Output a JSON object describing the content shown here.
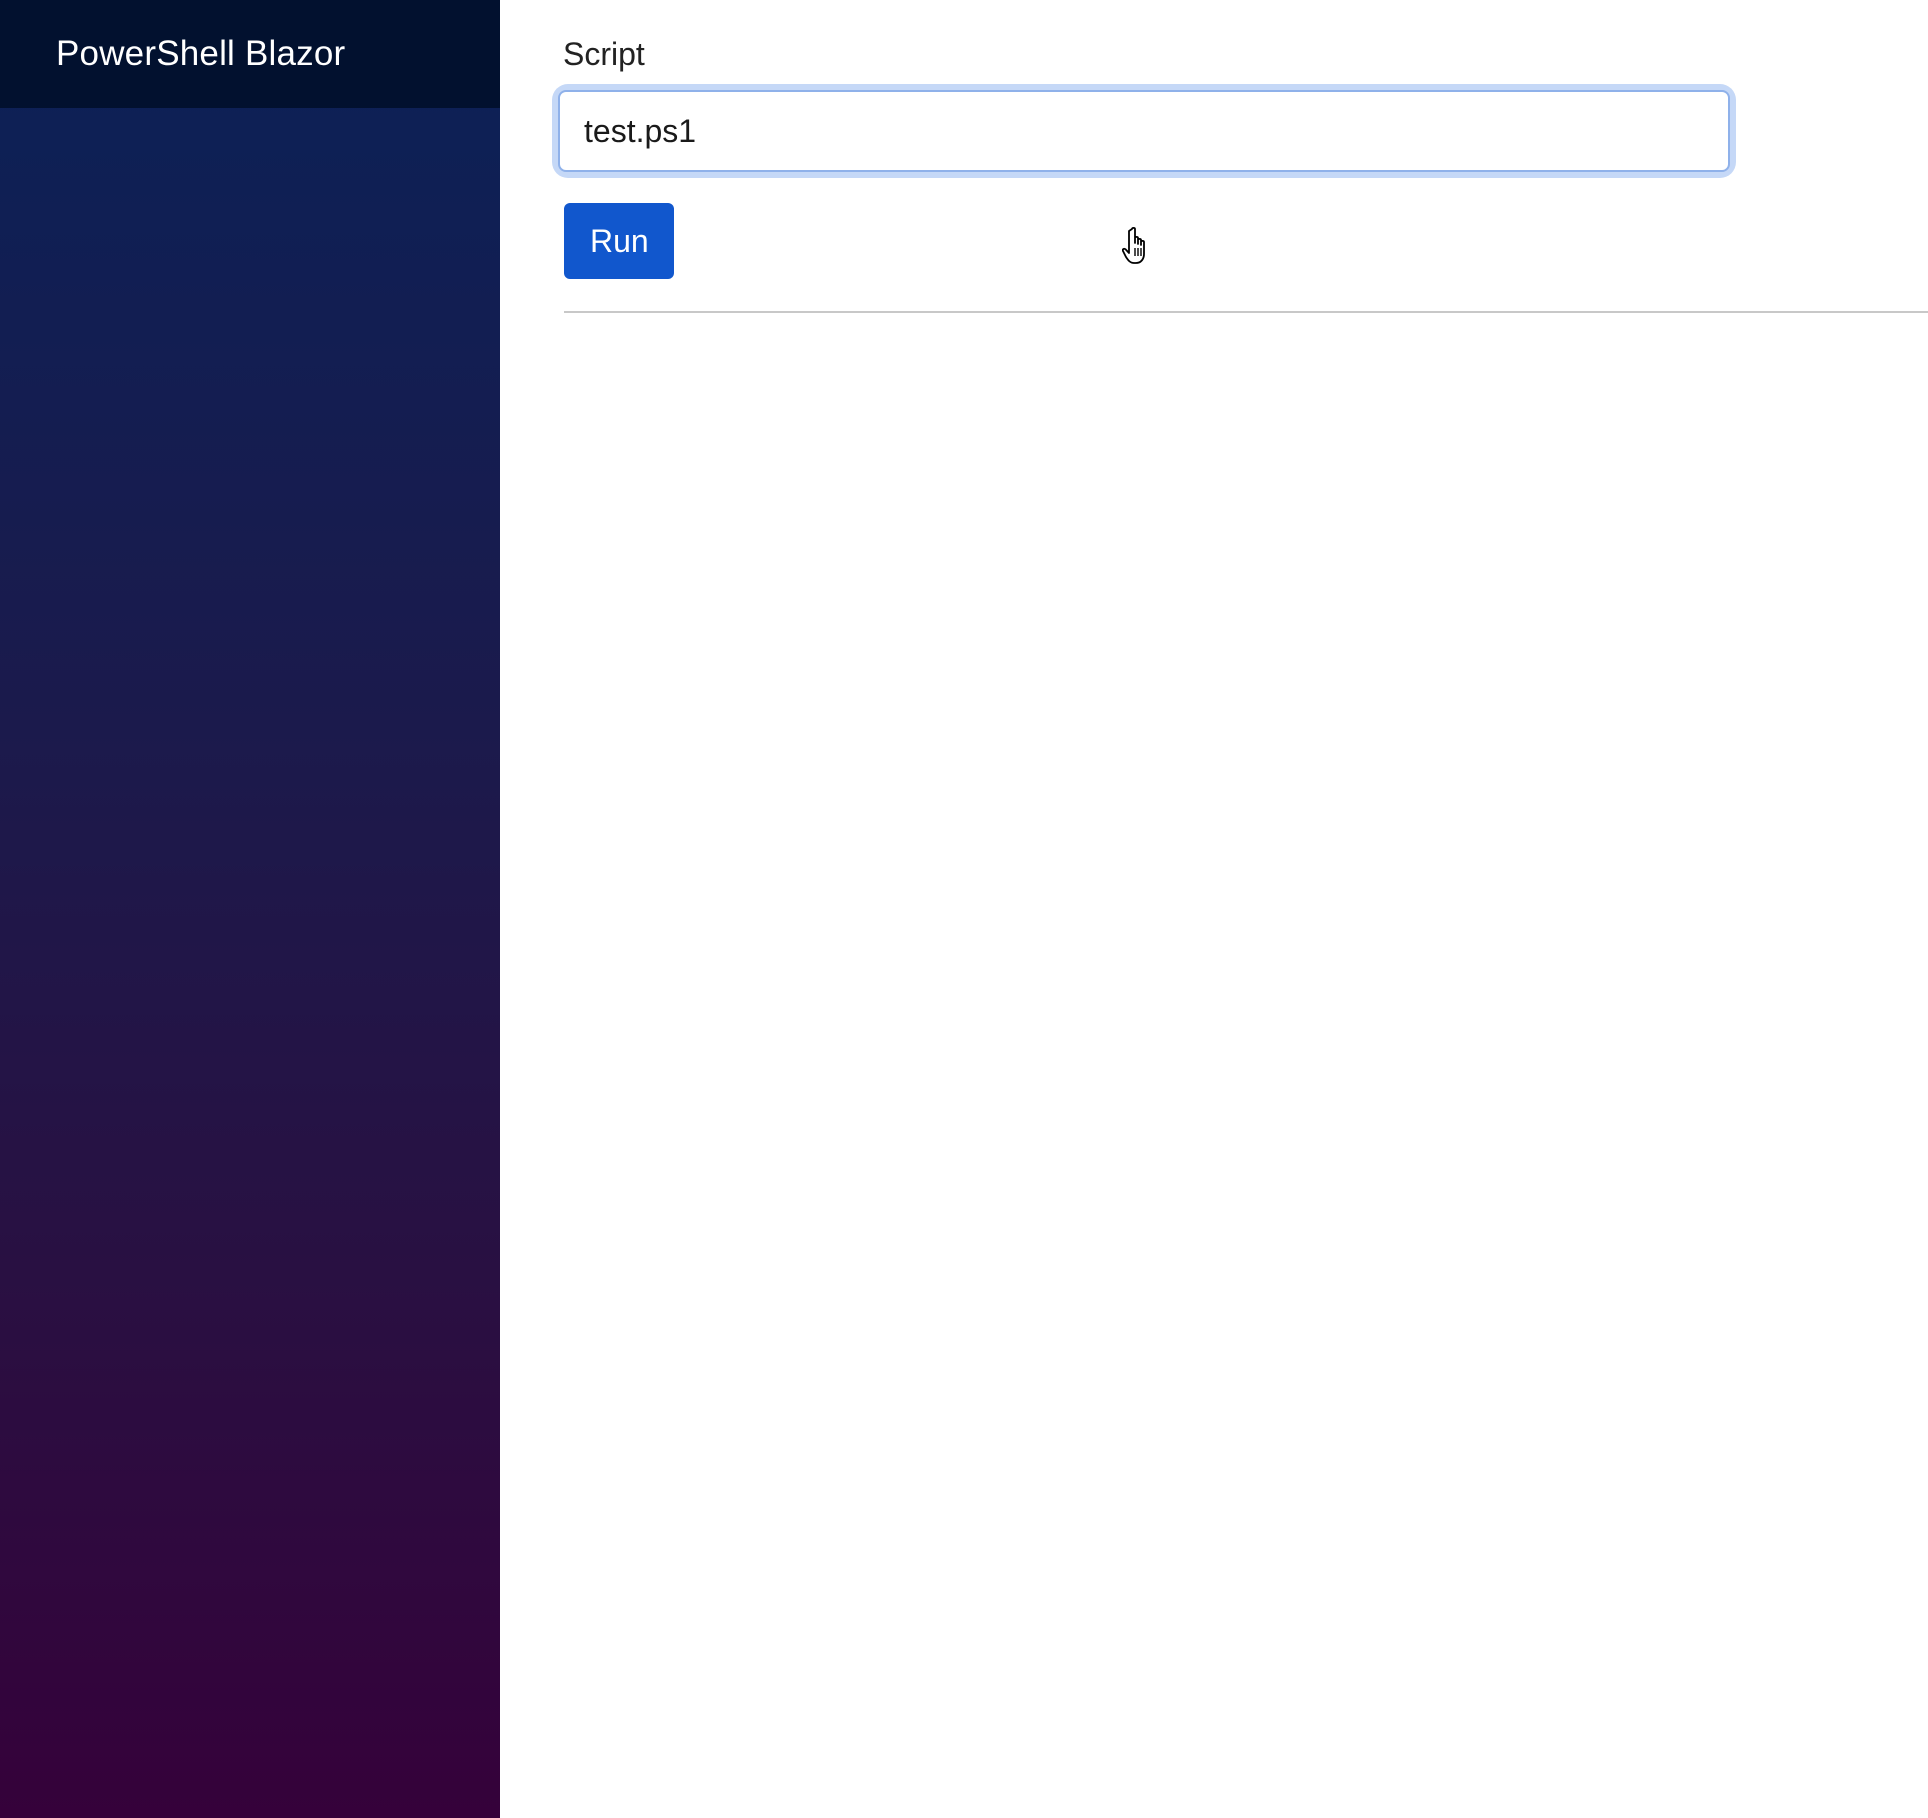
{
  "sidebar": {
    "brand": "PowerShell Blazor"
  },
  "form": {
    "label": "Script",
    "input_value": "test.ps1",
    "run_label": "Run"
  },
  "icons": {
    "cursor": "hand-pointer-icon"
  },
  "colors": {
    "brand_bar": "#02112f",
    "sidebar_top": "#0b2157",
    "sidebar_bottom": "#35013a",
    "primary_button": "#1157cd",
    "input_focus_ring": "#c5d8f7"
  }
}
